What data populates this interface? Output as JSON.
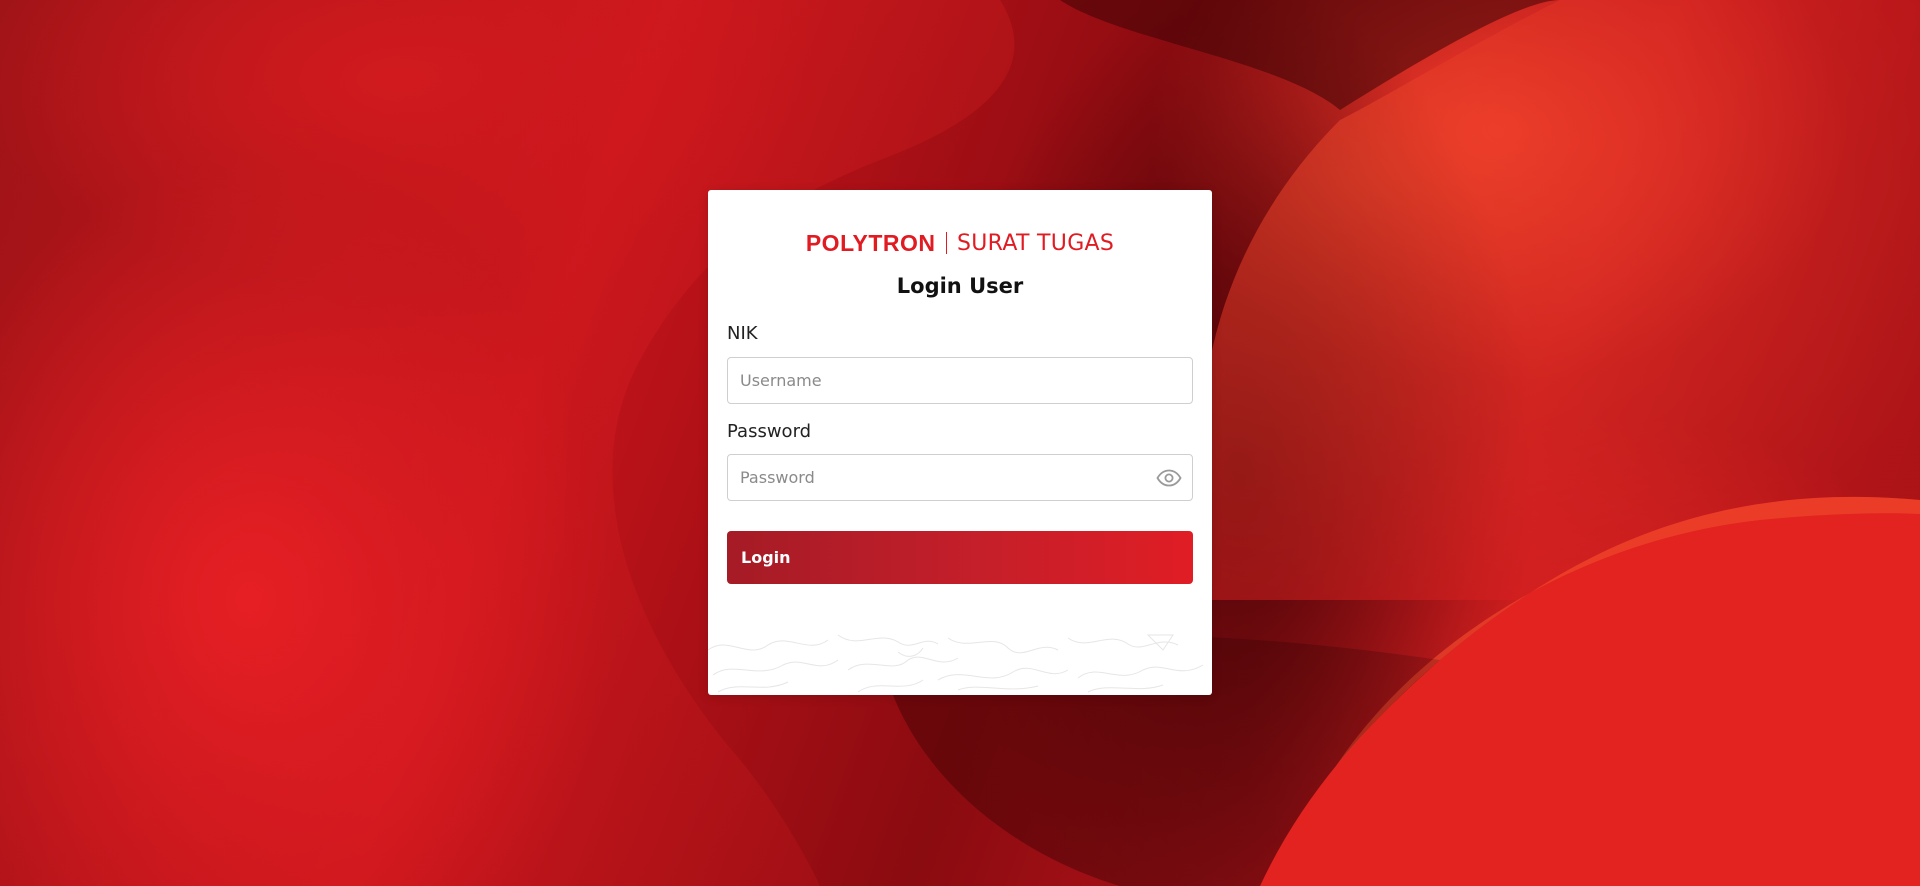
{
  "brand": {
    "logo": "POLYTRON",
    "app_name": "SURAT TUGAS",
    "color": "#e11b22"
  },
  "form": {
    "title": "Login User",
    "nik_label": "NIK",
    "nik_placeholder": "Username",
    "nik_value": "",
    "password_label": "Password",
    "password_placeholder": "Password",
    "password_value": "",
    "password_toggle_icon": "eye-icon",
    "submit_label": "Login"
  },
  "colors": {
    "background_accent": "#c5141b",
    "button_start": "#a51b26",
    "button_end": "#e01d25"
  }
}
